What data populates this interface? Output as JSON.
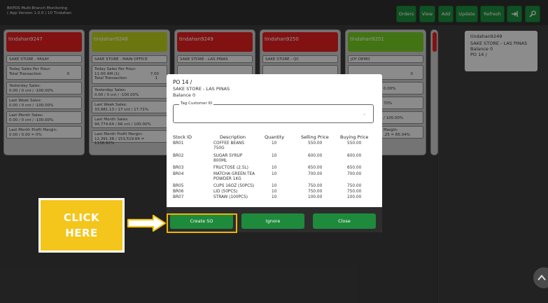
{
  "header": {
    "title_line1": "BitPOS Multi-Branch Monitoring",
    "title_line2": "( App Version 1.0.0 ) 10 Tindahan",
    "buttons": {
      "orders": "Orders",
      "view": "View",
      "add": "Add",
      "update": "Update",
      "refresh": "Refresh"
    }
  },
  "colors": {
    "accent_green": "#1e8a3c",
    "red_head": "#e02020",
    "olive_head": "#b9cc1e",
    "lime_head": "#74c823",
    "highlight": "#f4c51a"
  },
  "branches": [
    {
      "name": "tindahan9247",
      "store": "SAKE STORE - PASAY",
      "today_label": "Today Sales Per Hour:",
      "total_label": "Total Transaction",
      "total_value": "0",
      "yesterday_label": "Yesterday Sales:",
      "yesterday_value": "0.00 / 0 cnt / -100.00%",
      "lastweek_label": "Last Week Sales:",
      "lastweek_value": "0.00 / 0 cnt / -100.00%",
      "lastmonth_label": "Last Month Sales:",
      "lastmonth_value": "0.00 / 0 cnt / -100.00%",
      "margin_label": "Last Month Profit Margin:",
      "margin_value": "0.00 / 0.00 = 0%"
    },
    {
      "name": "tindahan9248",
      "store": "SAKE STORE - MAIN OFFICE",
      "today_label": "Today Sales Per Hour:",
      "today_time": "11:00 AM (1)",
      "today_value": "7.00",
      "total_label": "Total Transaction",
      "total_value": "1",
      "yesterday_label": "Yesterday Sales:",
      "yesterday_value": "0.00 / 0 cnt / -100.00%",
      "lastweek_label": "Last Week Sales:",
      "lastweek_value": "33,981.13 / 17 cnt / 17.71%",
      "lastmonth_label": "Last Month Sales:",
      "lastmonth_value": "94,774.64 / 66 cnt / 100.00%",
      "margin_label": "Last Month Profit Margin:",
      "margin_value": "12,391.38 / 153,519.64 = 1138.92%"
    },
    {
      "name": "tindahan9249",
      "store": "SAKE STORE - LAS PINAS"
    },
    {
      "name": "tindahan9250",
      "store": "SAKE STORE - QC"
    },
    {
      "name": "tindahan9251",
      "store": "JOY DEMO",
      "today_value": "0",
      "partial_a": "0.00%",
      "partial_b": "70%",
      "partial_c": "/ 100.00%",
      "partial_d": "Margin:",
      "partial_e": ".25 = 85.04%"
    }
  ],
  "side_panel": {
    "name": "tindahan9249",
    "store": "SAKE STORE - LAS PINAS",
    "balance": "Balance 0",
    "po": "PO 14 /"
  },
  "dialog": {
    "title": "PO 14 /",
    "store": "SAKE STORE - LAS PINAS",
    "balance": "Balance 0",
    "tag_label": "Tag Customer ID",
    "columns": [
      "Stock ID",
      "Description",
      "Quantity",
      "Selling Price",
      "Buying Price"
    ],
    "rows": [
      {
        "id": "BR01",
        "desc": "COFFEE BEANS 750G",
        "qty": "10",
        "sell": "550.00",
        "buy": "550.00"
      },
      {
        "id": "BR02",
        "desc": "SUGAR SYRUP 800ML",
        "qty": "10",
        "sell": "600.00",
        "buy": "600.00"
      },
      {
        "id": "BR03",
        "desc": "FRUCTOSE (2.5L)",
        "qty": "10",
        "sell": "650.00",
        "buy": "650.00"
      },
      {
        "id": "BR04",
        "desc": "MATCHA GREEN TEA POWDER 1KG",
        "qty": "10",
        "sell": "700.00",
        "buy": "700.00"
      },
      {
        "id": "BR05",
        "desc": "CUPS 16OZ (50PCS)",
        "qty": "10",
        "sell": "750.00",
        "buy": "750.00"
      },
      {
        "id": "BR06",
        "desc": "LID (50PCS)",
        "qty": "10",
        "sell": "750.00",
        "buy": "750.00"
      },
      {
        "id": "BR07",
        "desc": "STRAW (100PCS)",
        "qty": "10",
        "sell": "100.00",
        "buy": "100.00"
      }
    ],
    "buttons": {
      "create": "Create SO",
      "ignore": "Ignore",
      "close": "Close"
    }
  },
  "callout": {
    "line1": "CLICK",
    "line2": "HERE"
  },
  "icons": {
    "exit": "exit-icon",
    "tools": "tools-icon",
    "chevron": "chevron-up-icon"
  }
}
